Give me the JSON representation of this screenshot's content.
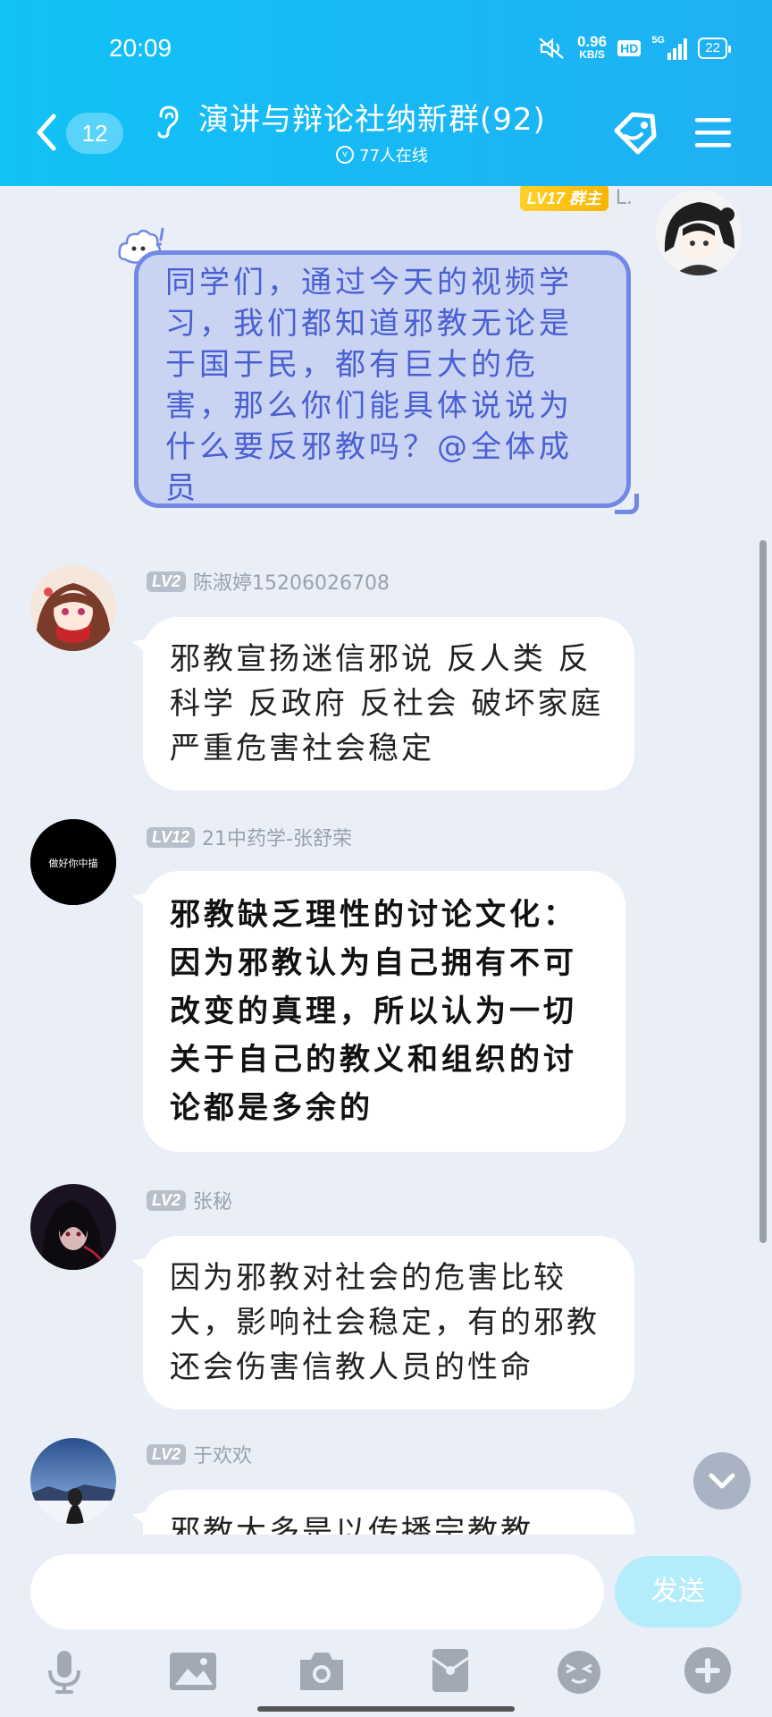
{
  "status_bar": {
    "time": "20:09",
    "speed_value": "0.96",
    "speed_unit": "KB/S",
    "hd": "HD",
    "network": "5G",
    "battery": "22"
  },
  "header": {
    "unread_count": "12",
    "title": "演讲与辩论社纳新群(92)",
    "online": "77人在线"
  },
  "owner_message": {
    "level": "LV17",
    "role": "群主",
    "name_fragment": "L.",
    "text": "同学们，通过今天的视频学习，我们都知道邪教无论是于国于民，都有巨大的危害，那么你们能具体说说为什么要反邪教吗？@全体成员"
  },
  "messages": [
    {
      "level": "LV2",
      "name": "陈淑婷15206026708",
      "text": "邪教宣扬迷信邪说 反人类 反科学 反政府 反社会 破坏家庭 严重危害社会稳定"
    },
    {
      "level": "LV12",
      "name": "21中药学-张舒荣",
      "avatar_text": "做好你中描",
      "text": "邪教缺乏理性的讨论文化：因为邪教认为自己拥有不可改变的真理，所以认为一切关于自己的教义和组织的讨论都是多余的"
    },
    {
      "level": "LV2",
      "name": "张秘",
      "text": "因为邪教对社会的危害比较大，影响社会稳定，有的邪教还会伤害信教人员的性命"
    },
    {
      "level": "LV2",
      "name": "于欢欢",
      "text": "邪教大多是以传播宗教教"
    }
  ],
  "input": {
    "placeholder": "",
    "send_label": "发送"
  },
  "toolbar": [
    "microphone-icon",
    "image-icon",
    "camera-icon",
    "red-packet-icon",
    "emoji-icon",
    "plus-icon"
  ],
  "colors": {
    "header": "#19b7f5",
    "owner_bubble_bg": "#c9d3f2",
    "owner_bubble_border": "#7288e6",
    "owner_text": "#4a5fd2",
    "level_gold": "#f7b500",
    "level_gray": "#b9bfca",
    "send_disabled": "#b5ecfb"
  }
}
